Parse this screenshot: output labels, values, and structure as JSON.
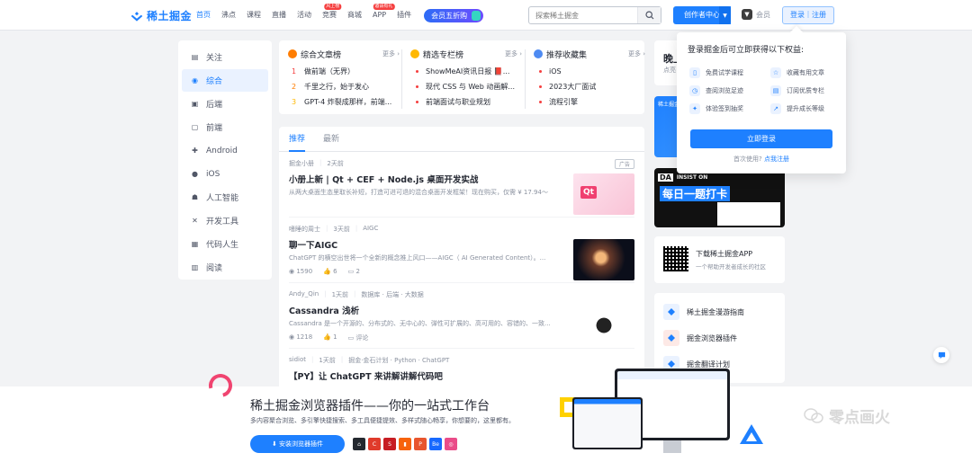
{
  "header": {
    "logo_text": "稀土掘金",
    "nav": [
      {
        "label": "首页",
        "active": true
      },
      {
        "label": "沸点"
      },
      {
        "label": "课程"
      },
      {
        "label": "直播"
      },
      {
        "label": "活动"
      },
      {
        "label": "竞赛",
        "badge": "风上榜"
      },
      {
        "label": "商城"
      },
      {
        "label": "APP",
        "badge": "邀请有礼"
      },
      {
        "label": "插件"
      }
    ],
    "vip_label": "会员五折购",
    "search_placeholder": "探索稀土掘金",
    "creator_label": "创作者中心",
    "member_label": "会员",
    "login_label": "登录｜注册"
  },
  "sidebar": {
    "items": [
      {
        "label": "关注",
        "icon": "follow-icon"
      },
      {
        "label": "综合",
        "icon": "compass-icon",
        "active": true
      },
      {
        "label": "后端",
        "icon": "backend-icon"
      },
      {
        "label": "前端",
        "icon": "frontend-icon"
      },
      {
        "label": "Android",
        "icon": "android-icon"
      },
      {
        "label": "iOS",
        "icon": "apple-icon"
      },
      {
        "label": "人工智能",
        "icon": "robot-icon"
      },
      {
        "label": "开发工具",
        "icon": "tools-icon"
      },
      {
        "label": "代码人生",
        "icon": "code-life-icon"
      },
      {
        "label": "阅读",
        "icon": "book-icon"
      }
    ]
  },
  "rankings": {
    "columns": [
      {
        "title": "综合文章榜",
        "more": "更多 ›",
        "color": "#ff7d00",
        "items": [
          {
            "num": "1",
            "text": "做前端（无界）"
          },
          {
            "num": "2",
            "text": "千里之行，始于发心"
          },
          {
            "num": "3",
            "text": "GPT-4 炸裂成那样，前端..."
          }
        ]
      },
      {
        "title": "精选专栏榜",
        "more": "更多 ›",
        "color": "#ffb800",
        "items": [
          {
            "text": "ShowMeAI资讯日报 📕..."
          },
          {
            "text": "现代 CSS 与 Web 动画解..."
          },
          {
            "text": "前端面试与职业规划"
          }
        ]
      },
      {
        "title": "推荐收藏集",
        "more": "更多 ›",
        "color": "#4e8bf2",
        "items": [
          {
            "text": "iOS"
          },
          {
            "text": "2023大厂面试"
          },
          {
            "text": "流程引擎"
          }
        ]
      }
    ]
  },
  "feed": {
    "tabs": [
      "推荐",
      "最新"
    ],
    "articles": [
      {
        "author": "掘金小册",
        "time": "2天前",
        "tags": "",
        "ad": "广告",
        "title": "小册上新 | Qt + CEF + Node.js 桌面开发实战",
        "desc": "从两大桌面生态里取长补短，打造可进可退的混合桌面开发框架！现在购买，仅需 ¥ 17.94～",
        "views": "",
        "likes": "",
        "comments": "",
        "thumb": "qt"
      },
      {
        "author": "嗜睡的周士",
        "time": "3天前",
        "tags": "AIGC",
        "ad": "",
        "title": "聊一下AIGC",
        "desc": "ChatGPT 的横空出世将一个全新的概念推上风口——AIGC（ AI Generated Content）。...",
        "views": "1590",
        "likes": "6",
        "comments": "2",
        "thumb": "space"
      },
      {
        "author": "Andy_Qin",
        "time": "1天前",
        "tags": "数据库 · 后端 · 大数据",
        "ad": "",
        "title": "Cassandra 浅析",
        "desc": "Cassandra 是一个开源的、分布式的、无中心的、弹性可扩展的、高可用的、容错的、一致...",
        "views": "1218",
        "likes": "1",
        "comments": "评论",
        "thumb": "graph"
      },
      {
        "author": "sidiot",
        "time": "1天前",
        "tags": "掘金·金石计划 · Python · ChatGPT",
        "ad": "",
        "title": "【PY】让 ChatGPT 来讲解讲解代码吧",
        "desc": "",
        "views": "",
        "likes": "",
        "comments": "",
        "thumb": ""
      }
    ]
  },
  "right": {
    "welcome": "晚上",
    "welcome_sub": "点亮",
    "banner1_text": "稀土掘金",
    "banner2_head": "DA",
    "banner2_sub": "INSIST ON",
    "banner2_big": "每日一题打卡",
    "app_title": "下载稀土掘金APP",
    "app_sub": "一个帮助开发者成长的社区",
    "links": [
      {
        "label": "稀土掘金漫游指南",
        "icon": "guide-icon"
      },
      {
        "label": "掘金浏览器插件",
        "icon": "chrome-icon"
      },
      {
        "label": "掘金翻译计划",
        "icon": "translate-icon"
      }
    ]
  },
  "popup": {
    "title": "登录掘金后可立即获得以下权益:",
    "benefits": [
      {
        "label": "免费试学课程",
        "icon": "book-open-icon"
      },
      {
        "label": "收藏有用文章",
        "icon": "star-icon"
      },
      {
        "label": "查阅浏览足迹",
        "icon": "history-icon"
      },
      {
        "label": "订阅优质专栏",
        "icon": "subscribe-icon"
      },
      {
        "label": "体验签到抽奖",
        "icon": "gift-icon"
      },
      {
        "label": "提升成长等级",
        "icon": "growth-icon"
      }
    ],
    "login_button": "立即登录",
    "foot_text": "首次使用?",
    "foot_link": "点我注册"
  },
  "bottom_banner": {
    "title": "稀土掘金浏览器插件——你的一站式工作台",
    "subtitle": "多内容聚合浏览、多引擎快捷搜索、多工具便捷提效、多样式随心畅享，你想要的，这里都有。",
    "install": "安装浏览器插件",
    "browsers": [
      {
        "glyph": "⌂",
        "color": "#24292f"
      },
      {
        "glyph": "C",
        "color": "#e03b2b"
      },
      {
        "glyph": "S",
        "color": "#c71d23"
      },
      {
        "glyph": "▮",
        "color": "#f7630c"
      },
      {
        "glyph": "P",
        "color": "#e8552d"
      },
      {
        "glyph": "Be",
        "color": "#1769ff"
      },
      {
        "glyph": "◎",
        "color": "#ea4c89"
      }
    ],
    "watermark": "零点画火"
  }
}
